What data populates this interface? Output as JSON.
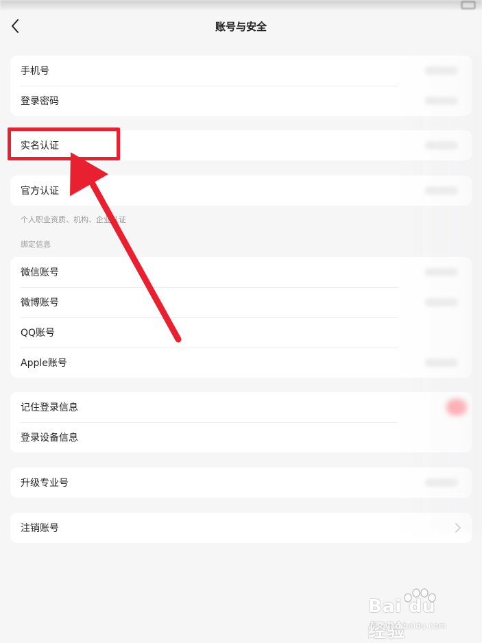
{
  "header": {
    "title": "账号与安全"
  },
  "sections": {
    "account": [
      {
        "label": "手机号"
      },
      {
        "label": "登录密码"
      }
    ],
    "realname": {
      "label": "实名认证"
    },
    "official": {
      "label": "官方认证",
      "note": "个人职业资质、机构、企业认证"
    },
    "binding_header": "绑定信息",
    "binding": [
      {
        "label": "微信账号"
      },
      {
        "label": "微博账号"
      },
      {
        "label": "QQ账号"
      },
      {
        "label": "Apple账号"
      }
    ],
    "login": [
      {
        "label": "记住登录信息"
      },
      {
        "label": "登录设备信息"
      }
    ],
    "upgrade": {
      "label": "升级专业号"
    },
    "cancel": {
      "label": "注销账号"
    }
  },
  "annotation": {
    "color": "#e8202f"
  },
  "watermark": {
    "brand": "Bai du 经验",
    "url": "jingyan.baidu.com"
  },
  "icons": {
    "back": "chevron-left-icon",
    "row_arrow": "chevron-right-icon"
  }
}
